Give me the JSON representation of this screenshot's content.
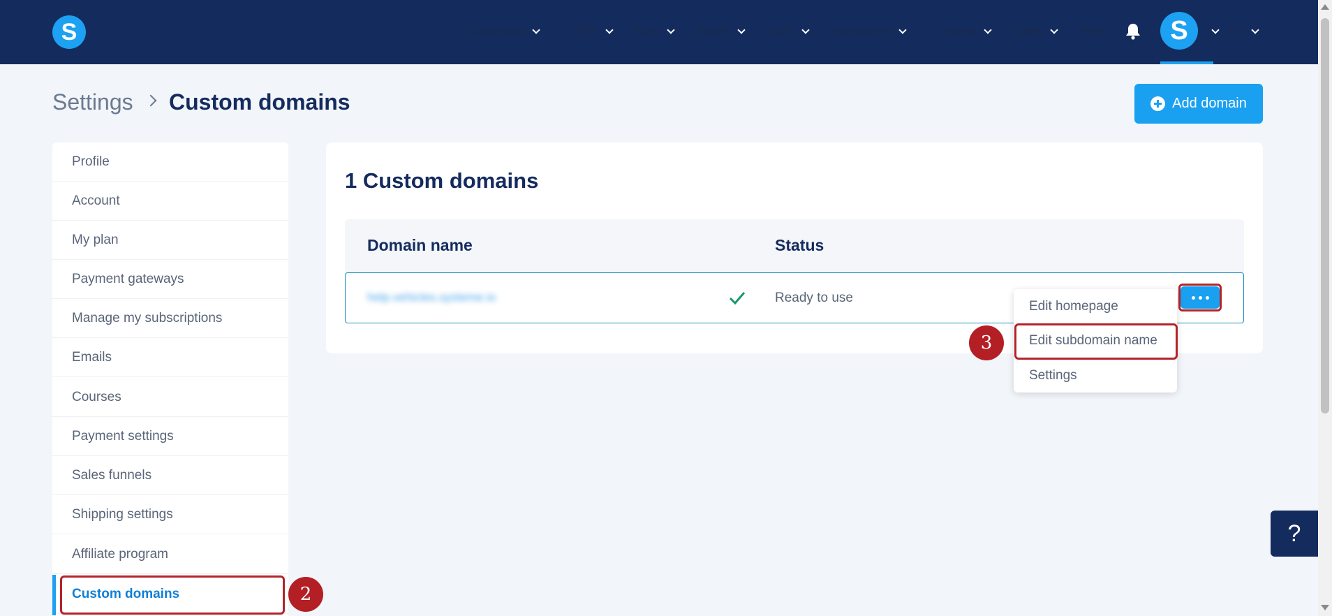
{
  "nav": {
    "items": [
      {
        "label": "Dashboard",
        "dropdown": true
      },
      {
        "label": "CRM",
        "dropdown": true
      },
      {
        "label": "Sites",
        "dropdown": true
      },
      {
        "label": "Emails",
        "dropdown": true
      },
      {
        "label": "SMS",
        "dropdown": true
      },
      {
        "label": "Automations",
        "dropdown": true
      },
      {
        "label": "Assets",
        "dropdown": true
      },
      {
        "label": "Sales",
        "dropdown": true
      },
      {
        "label": "Help",
        "dropdown": false
      }
    ],
    "logo_letter": "S",
    "avatar_letter": "S",
    "language": "EN"
  },
  "breadcrumb": {
    "parent": "Settings",
    "current": "Custom domains"
  },
  "add_domain_label": "Add domain",
  "sidebar": {
    "items": [
      {
        "label": "Profile"
      },
      {
        "label": "Account"
      },
      {
        "label": "My plan"
      },
      {
        "label": "Payment gateways"
      },
      {
        "label": "Manage my subscriptions"
      },
      {
        "label": "Emails"
      },
      {
        "label": "Courses"
      },
      {
        "label": "Payment settings"
      },
      {
        "label": "Sales funnels"
      },
      {
        "label": "Shipping settings"
      },
      {
        "label": "Affiliate program"
      },
      {
        "label": "Custom domains",
        "active": true
      }
    ]
  },
  "main": {
    "title": "1 Custom domains",
    "columns": {
      "domain": "Domain name",
      "status": "Status"
    },
    "rows": [
      {
        "domain": "help.vehicles.systeme.io",
        "status": "Ready to use"
      }
    ]
  },
  "menu": {
    "items": [
      "Edit homepage",
      "Edit subdomain name",
      "Settings"
    ]
  },
  "steps": {
    "sidebar_step": "2",
    "menu_step": "3"
  },
  "help_label": "?",
  "colors": {
    "topbar": "#142b5e",
    "accent": "#1aa0f0",
    "highlight": "#b42329",
    "success": "#1a9a6b"
  }
}
